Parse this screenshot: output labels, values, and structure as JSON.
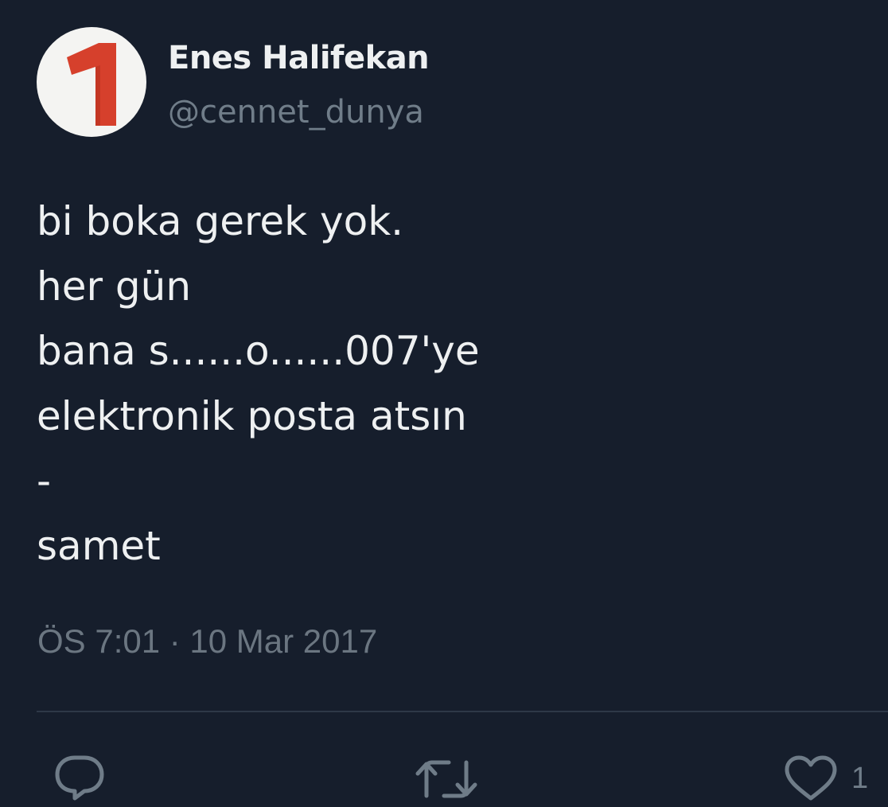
{
  "tweet": {
    "author": {
      "display_name": "Enes Halifekan",
      "handle": "@cennet_dunya",
      "avatar_icon": "number-one-logo",
      "avatar_colors": {
        "background": "#f4f4f2",
        "glyph": "#d6402c"
      }
    },
    "text_lines": [
      "bi boka gerek yok.",
      "her gün",
      "bana s......o......007'ye",
      "elektronik posta atsın",
      "-",
      "samet"
    ],
    "timestamp": "ÖS 7:01 · 10 Mar 2017",
    "actions": {
      "reply_icon": "reply-bubble-icon",
      "retweet_icon": "retweet-icon",
      "like_icon": "heart-icon",
      "like_count": "1"
    }
  },
  "theme": {
    "background": "#161e2c",
    "text": "#eef0f1",
    "muted": "#707d89",
    "divider": "#2e3847"
  }
}
